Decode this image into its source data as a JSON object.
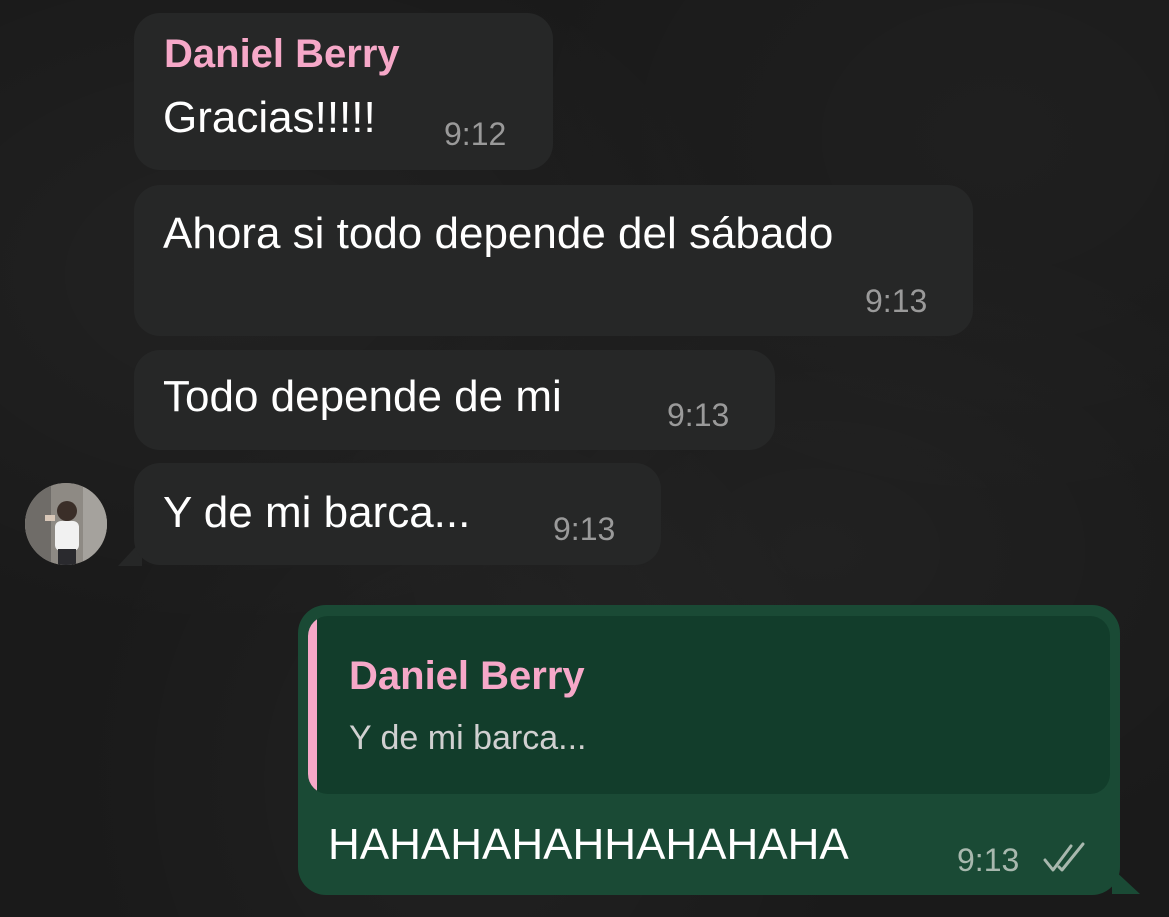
{
  "messages": [
    {
      "sender": "Daniel Berry",
      "text": "Gracias!!!!!",
      "time": "9:12"
    },
    {
      "text": "Ahora si todo depende del sábado",
      "time": "9:13"
    },
    {
      "text": "Todo depende de mi",
      "time": "9:13"
    },
    {
      "text": "Y de mi barca...",
      "time": "9:13"
    }
  ],
  "reply": {
    "quoted_sender": "Daniel Berry",
    "quoted_text": "Y de mi barca...",
    "text": "HAHAHAHAHHAHAHAHA",
    "time": "9:13",
    "status_icon": "double-check-icon"
  },
  "colors": {
    "incoming_bubble": "#262727",
    "outgoing_bubble": "#1a4a35",
    "quote_background": "#123d2b",
    "sender_name": "#f6a8c8",
    "timestamp": "#9a9a9a",
    "background": "#1a1a1a"
  }
}
